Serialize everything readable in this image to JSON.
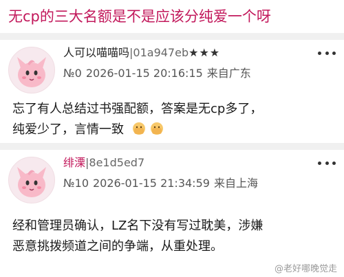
{
  "thread": {
    "title": "无cp的三大名额是不是应该分纯爱一个呀"
  },
  "posts": [
    {
      "username": "人可以喵喵吗",
      "uid": "|01a947eb",
      "stars": "★★★",
      "floor": "№0",
      "datetime": "2026-01-15 20:16:15",
      "location": "来自广东",
      "lines": [
        "忘了有人总结过书强配额，答案是无cp多了，",
        "纯爱少了，言情一致"
      ],
      "emoji_icons": [
        "facepalm-emoji-icon",
        "facepalm-emoji-icon"
      ]
    },
    {
      "username": "绯溧",
      "uid": "|8e1d5ed7",
      "floor": "№10",
      "datetime": "2026-01-15 21:34:59",
      "location": "来自上海",
      "lines": [
        "经和管理员确认，LZ名下没有写过耽美，涉嫌",
        "恶意挑拨频道之间的争端，从重处理。"
      ]
    }
  ],
  "watermark": {
    "text": "@老好哪晚觉走"
  },
  "colors": {
    "accent": "#c2185b",
    "separator": "#f0f0f0",
    "text": "#1a1a1a"
  }
}
